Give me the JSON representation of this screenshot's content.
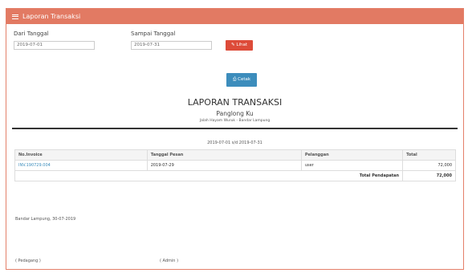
{
  "panel": {
    "title": "Laporan Transaksi"
  },
  "filter": {
    "from_label": "Dari Tanggal",
    "from_value": "2019-07-01",
    "to_label": "Sampai Tanggal",
    "to_value": "2019-07-31",
    "lihat_label": "Lihat"
  },
  "cetak_label": "Cetak",
  "report": {
    "title": "LAPORAN TRANSAKSI",
    "shop": "Panglong Ku",
    "address": "Jalah Hayam Wuruk - Bandar Lampung",
    "period": "2019-07-01 s/d 2019-07-31"
  },
  "table": {
    "headers": [
      "No.Invoice",
      "Tanggal Pesan",
      "Pelanggan",
      "Total"
    ],
    "rows": [
      {
        "invoice": "INV.190729.004",
        "date": "2019-07-29",
        "customer": "user",
        "total": "72,000"
      }
    ],
    "total_label": "Total Pendapatan",
    "total_value": "72,000"
  },
  "footer": {
    "place_date": "Bandar Lampung, 30-07-2019",
    "sign_left": "( Pedagang )",
    "sign_right": "( Admin )"
  }
}
